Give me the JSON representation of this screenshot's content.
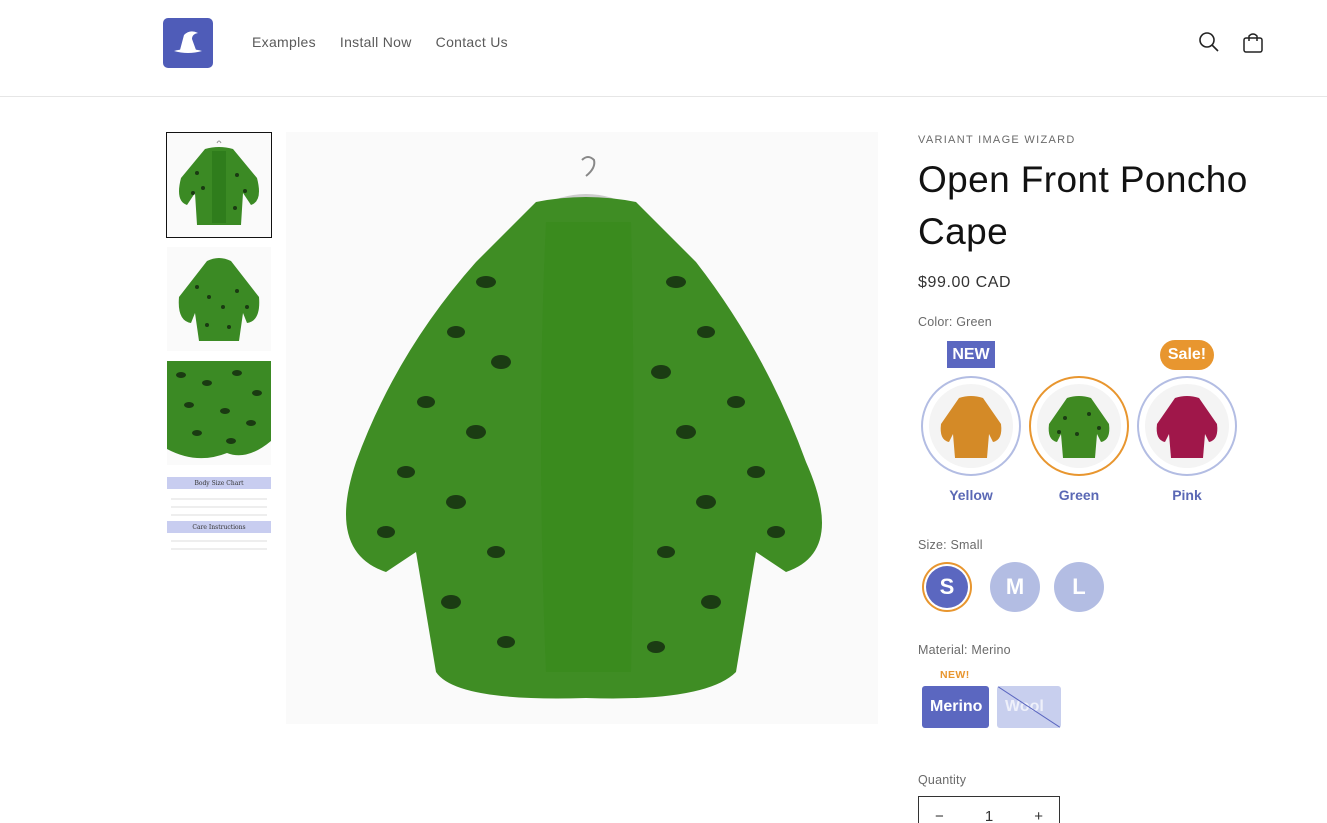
{
  "nav": {
    "logo_icon": "wizard-hat-icon",
    "links": [
      "Examples",
      "Install Now",
      "Contact Us"
    ],
    "search_icon": "search-icon",
    "cart_icon": "cart-icon"
  },
  "gallery": {
    "thumbnails": [
      {
        "label": "",
        "icon": "cape-front-thumb"
      },
      {
        "label": "",
        "icon": "cape-back-thumb"
      },
      {
        "label": "",
        "icon": "cape-detail-thumb"
      },
      {
        "label": "Body Size Chart",
        "label2": "Care Instructions"
      }
    ]
  },
  "product": {
    "vendor": "VARIANT IMAGE WIZARD",
    "title_line1": "Open Front Poncho",
    "title_line2": "Cape",
    "price": "$99.00 CAD",
    "color_label": "Color: Green",
    "colors": [
      {
        "name": "Yellow",
        "badge": "NEW",
        "swatch": "#d48a27"
      },
      {
        "name": "Green",
        "badge": "",
        "swatch": "#3f8a22"
      },
      {
        "name": "Pink",
        "badge": "Sale!",
        "swatch": "#a0174a"
      }
    ],
    "size_label": "Size: Small",
    "sizes": [
      "S",
      "M",
      "L"
    ],
    "material_label": "Material: Merino",
    "material_badge": "NEW!",
    "materials": [
      "Merino",
      "Wool"
    ],
    "quantity_label": "Quantity",
    "quantity": "1",
    "qty_minus": "−",
    "qty_plus": "+"
  },
  "colors": {
    "accent": "#5b67c0",
    "accent_light": "#b3bde3",
    "selected_ring": "#e8962f"
  }
}
